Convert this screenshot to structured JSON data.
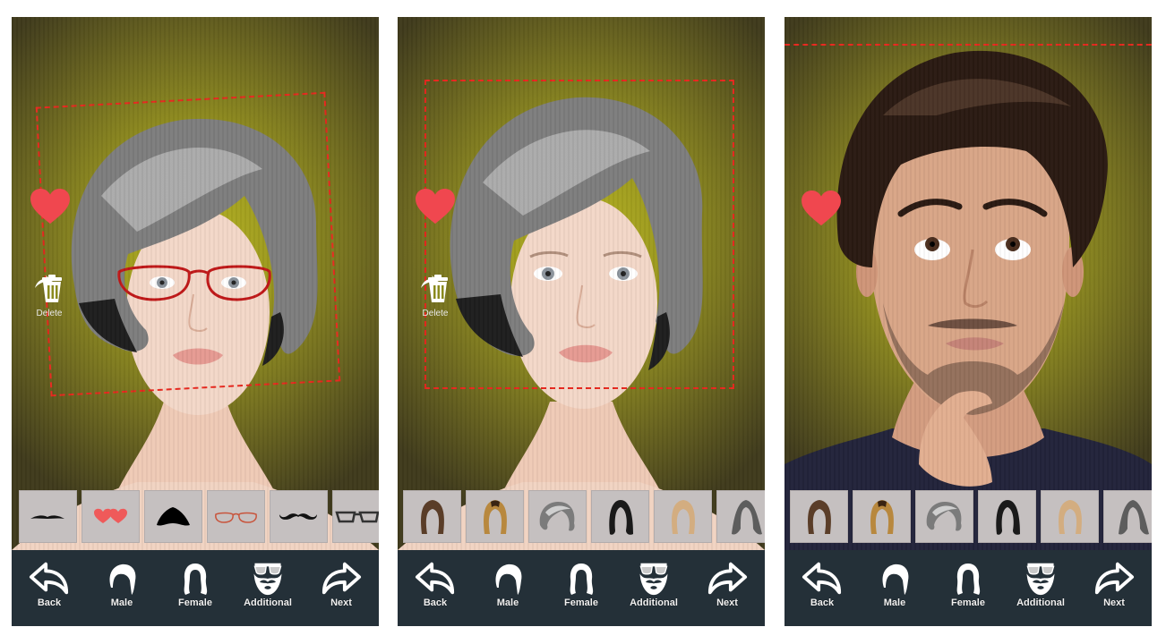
{
  "screens": [
    {
      "id": "accessory-edit",
      "active_category": "Additional",
      "side_controls": {
        "favorite_icon": "heart-icon",
        "delete_label": "Delete"
      },
      "thumbnails": [
        {
          "name": "thin-mustache",
          "icon": "mustache-thin-icon"
        },
        {
          "name": "heart-glasses",
          "icon": "heart-glasses-icon"
        },
        {
          "name": "beard-goatee",
          "icon": "beard-icon"
        },
        {
          "name": "red-glasses",
          "icon": "red-glasses-icon"
        },
        {
          "name": "curled-mustache",
          "icon": "mustache-curled-icon"
        },
        {
          "name": "black-glasses",
          "icon": "black-glasses-icon"
        }
      ]
    },
    {
      "id": "female-hair-edit",
      "active_category": "Female",
      "side_controls": {
        "favorite_icon": "heart-icon",
        "delete_label": "Delete"
      },
      "thumbnails": [
        {
          "name": "brown-long-hair",
          "icon": "hair-brown-icon"
        },
        {
          "name": "blonde-long-hair",
          "icon": "hair-blonde-icon"
        },
        {
          "name": "gray-bob-hair",
          "icon": "hair-gray-bob-icon"
        },
        {
          "name": "black-wavy-hair",
          "icon": "hair-black-icon"
        },
        {
          "name": "light-blonde-hair",
          "icon": "hair-light-blonde-icon"
        },
        {
          "name": "gray-long-hair",
          "icon": "hair-gray-long-icon"
        }
      ]
    },
    {
      "id": "male-photo-edit",
      "active_category": "Female",
      "side_controls": {
        "favorite_icon": "heart-icon"
      },
      "thumbnails": [
        {
          "name": "brown-long-hair",
          "icon": "hair-brown-icon"
        },
        {
          "name": "blonde-long-hair",
          "icon": "hair-blonde-icon"
        },
        {
          "name": "gray-bob-hair",
          "icon": "hair-gray-bob-icon"
        },
        {
          "name": "black-wavy-hair",
          "icon": "hair-black-icon"
        },
        {
          "name": "light-blonde-hair",
          "icon": "hair-light-blonde-icon"
        },
        {
          "name": "gray-long-hair",
          "icon": "hair-gray-long-icon"
        }
      ]
    }
  ],
  "bottom_nav": {
    "back": "Back",
    "male": "Male",
    "female": "Female",
    "additional": "Additional",
    "next": "Next"
  },
  "colors": {
    "nav_bar": "#243038",
    "heart": "#f0474f",
    "selection_dash": "#e8281e",
    "thumb_bg": "#c5c0c0",
    "background_olive": "#9d9a1e"
  }
}
